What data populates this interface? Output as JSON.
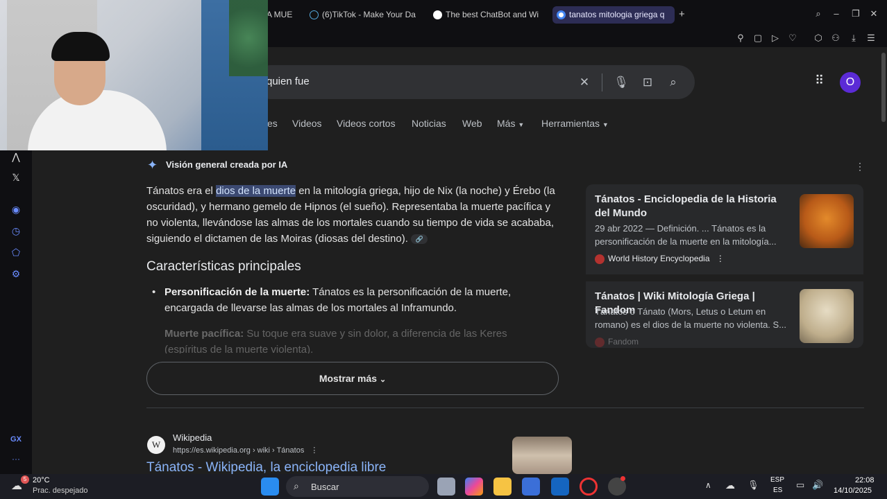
{
  "tabs": [
    {
      "label": "A MUΕ",
      "color": "#e34a4a"
    },
    {
      "label": "(6)TikTok - Make Your Da",
      "color": "#111111"
    },
    {
      "label": "The best ChatBot and Wi",
      "color": "#ffffff"
    },
    {
      "label": "tanatos mitologia griega q",
      "color": "#4285f4"
    }
  ],
  "new_tab": "+",
  "search": {
    "query": "quien fue"
  },
  "account_initial": "O",
  "nav_tabs": [
    "es",
    "Videos",
    "Videos cortos",
    "Noticias",
    "Web",
    "Más",
    "Herramientas"
  ],
  "ai_overview": {
    "header": "Visión general creada por IA",
    "body_pre": "Tánatos era el ",
    "body_hl": "dios de la muerte",
    "body_post": " en la mitología griega, hijo de Nix (la noche) y Érebo (la oscuridad), y hermano gemelo de Hipnos (el sueño). Representaba la muerte pacífica y no violenta, llevándose las almas de los mortales cuando su tiempo de vida se acababa, siguiendo el dictamen de las Moiras (diosas del destino).",
    "features_title": "Características principales",
    "bullet1_bold": "Personificación de la muerte:",
    "bullet1_text": " Tánatos es la personificación de la muerte, encargada de llevarse las almas de los mortales al Inframundo.",
    "bullet2_bold": "Muerte pacífica:",
    "bullet2_text": " Su toque era suave y sin dolor, a diferencia de las Keres (espíritus de la muerte violenta).",
    "show_more": "Mostrar más"
  },
  "cards": [
    {
      "title": "Tánatos - Enciclopedia de la Historia del Mundo",
      "text": "29 abr 2022 — Definición. ... Tánatos es la personificación de la muerte en la mitología...",
      "source": "World History Encyclopedia"
    },
    {
      "title": "Tánatos | Wiki Mitología Griega | Fandom",
      "text": "Tánatos o Tánato (Mors, Letus o Letum en romano) es el dios de la muerte no violenta. S...",
      "source": "Fandom"
    }
  ],
  "result": {
    "site": "Wikipedia",
    "url": "https://es.wikipedia.org › wiki › Tánatos",
    "title": "Tánatos - Wikipedia, la enciclopedia libre"
  },
  "taskbar": {
    "weather_temp": "20°C",
    "weather_desc": "Prac. despejado",
    "weather_badge": "5",
    "search_label": "Buscar",
    "lang1": "ESP",
    "lang2": "ES",
    "time": "22:08",
    "date": "14/10/2025"
  },
  "sidebar_labels": {
    "gx": "GX",
    "more": "···"
  }
}
